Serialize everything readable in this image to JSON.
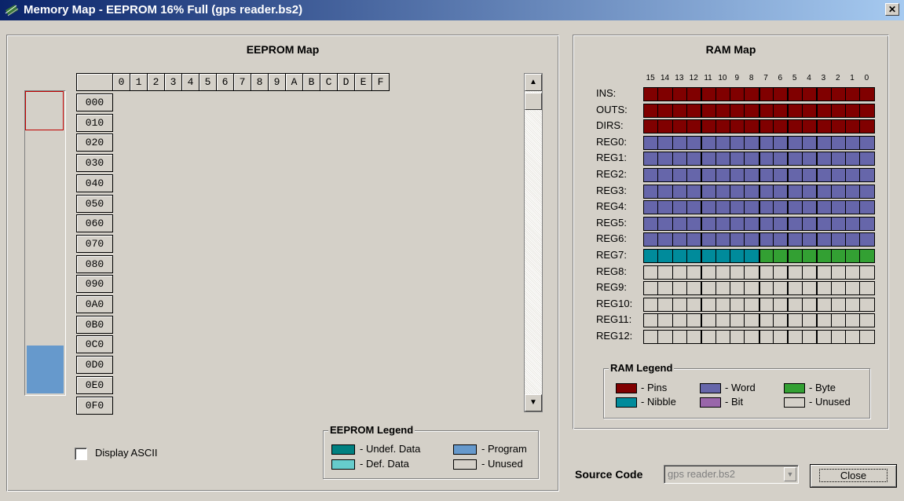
{
  "window": {
    "title": "Memory Map - EEPROM 16% Full (gps reader.bs2)",
    "close_glyph": "✕"
  },
  "eeprom": {
    "title": "EEPROM Map",
    "col_headers": [
      "0",
      "1",
      "2",
      "3",
      "4",
      "5",
      "6",
      "7",
      "8",
      "9",
      "A",
      "B",
      "C",
      "D",
      "E",
      "F"
    ],
    "row_headers": [
      "000",
      "010",
      "020",
      "030",
      "040",
      "050",
      "060",
      "070",
      "080",
      "090",
      "0A0",
      "0B0",
      "0C0",
      "0D0",
      "0E0",
      "0F0"
    ],
    "usage_fill_fraction": 0.16,
    "display_ascii_label": "Display ASCII",
    "display_ascii_checked": false,
    "legend": {
      "title": "EEPROM Legend",
      "items": [
        {
          "label": "- Undef. Data",
          "color": "#008080"
        },
        {
          "label": "- Program",
          "color": "#6699cc"
        },
        {
          "label": "- Def. Data",
          "color": "#66cccc"
        },
        {
          "label": "- Unused",
          "color": "#d4d0c8"
        }
      ]
    }
  },
  "ram": {
    "title": "RAM Map",
    "bit_headers": [
      "15",
      "14",
      "13",
      "12",
      "11",
      "10",
      "9",
      "8",
      "7",
      "6",
      "5",
      "4",
      "3",
      "2",
      "1",
      "0"
    ],
    "rows": [
      {
        "label": "INS:",
        "kind": "pins"
      },
      {
        "label": "OUTS:",
        "kind": "pins"
      },
      {
        "label": "DIRS:",
        "kind": "pins"
      },
      {
        "label": "REG0:",
        "kind": "word"
      },
      {
        "label": "REG1:",
        "kind": "word"
      },
      {
        "label": "REG2:",
        "kind": "word"
      },
      {
        "label": "REG3:",
        "kind": "word"
      },
      {
        "label": "REG4:",
        "kind": "word"
      },
      {
        "label": "REG5:",
        "kind": "word"
      },
      {
        "label": "REG6:",
        "kind": "word"
      },
      {
        "label": "REG7:",
        "kind": "nibble_byte"
      },
      {
        "label": "REG8:",
        "kind": "unused"
      },
      {
        "label": "REG9:",
        "kind": "unused"
      },
      {
        "label": "REG10:",
        "kind": "unused"
      },
      {
        "label": "REG11:",
        "kind": "unused"
      },
      {
        "label": "REG12:",
        "kind": "unused"
      }
    ],
    "colors": {
      "pins": "#800000",
      "word": "#6666aa",
      "nibble": "#008b9b",
      "byte": "#33a033",
      "bit": "#9966aa",
      "unused": "#d4d0c8"
    },
    "legend": {
      "title": "RAM Legend",
      "items": [
        {
          "label": "- Pins",
          "color": "#800000"
        },
        {
          "label": "- Word",
          "color": "#6666aa"
        },
        {
          "label": "- Byte",
          "color": "#33a033"
        },
        {
          "label": "- Nibble",
          "color": "#008b9b"
        },
        {
          "label": "- Bit",
          "color": "#9966aa"
        },
        {
          "label": "- Unused",
          "color": "#d4d0c8"
        }
      ]
    }
  },
  "footer": {
    "source_code_label": "Source Code",
    "source_code_value": "gps reader.bs2",
    "close_label": "Close"
  }
}
